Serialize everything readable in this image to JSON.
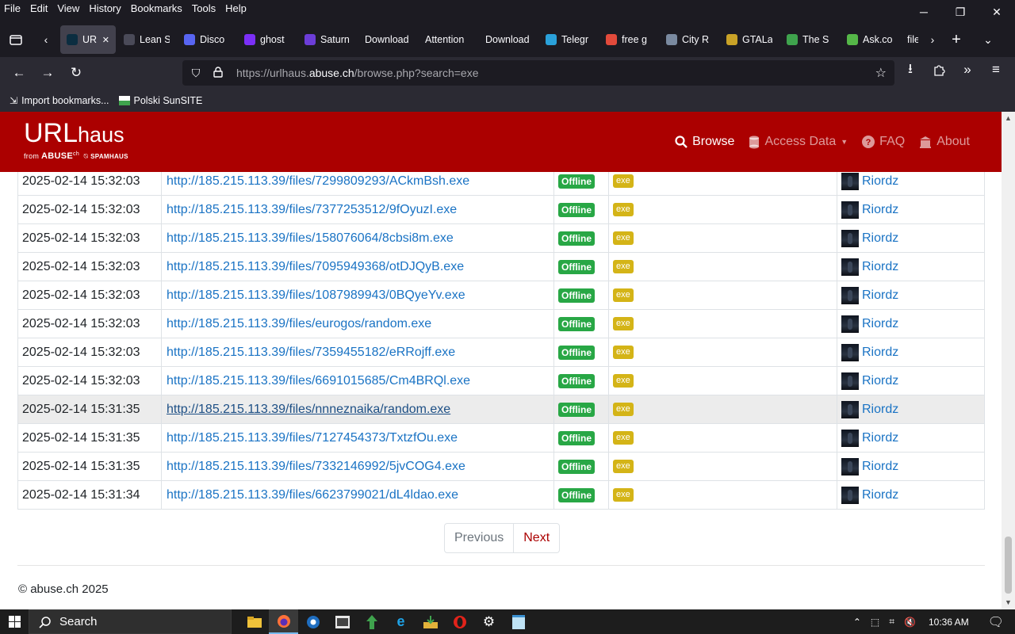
{
  "menu": [
    "File",
    "Edit",
    "View",
    "History",
    "Bookmarks",
    "Tools",
    "Help"
  ],
  "window_controls": {
    "minimize": "─",
    "restore": "❐",
    "close": "✕"
  },
  "tabs": [
    {
      "label": "URL",
      "color": "#0b2d40",
      "active": true
    },
    {
      "label": "Lean S",
      "color": "#4a4a58"
    },
    {
      "label": "Disco",
      "color": "#5865f2"
    },
    {
      "label": "ghost",
      "color": "#7b2ff7"
    },
    {
      "label": "Saturn",
      "color": "#6c3dd8"
    },
    {
      "label": "Download",
      "color": ""
    },
    {
      "label": "Attention",
      "color": ""
    },
    {
      "label": "Download",
      "color": ""
    },
    {
      "label": "Telegr",
      "color": "#2aa1da"
    },
    {
      "label": "free g",
      "color": "#e24a3b"
    },
    {
      "label": "City R",
      "color": "#7a8aa0"
    },
    {
      "label": "GTALa",
      "color": "#c9a227"
    },
    {
      "label": "The S",
      "color": "#3fa34d"
    },
    {
      "label": "Ask.co",
      "color": "#55b748"
    },
    {
      "label": "file",
      "color": ""
    }
  ],
  "url": {
    "prefix": "https://urlhaus.",
    "domain": "abuse.ch",
    "path": "/browse.php?search=exe"
  },
  "bookmarks": [
    "Import bookmarks...",
    "Polski SunSITE"
  ],
  "site": {
    "logo_main": "URL",
    "logo_sub": "haus",
    "logo_from": "from",
    "logo_abuse": "ABUSE",
    "logo_ch": "ch",
    "logo_spamhaus": "SPAMHAUS",
    "nav": [
      {
        "label": "Browse",
        "icon": "search-icon",
        "active": true
      },
      {
        "label": "Access Data",
        "icon": "database-icon",
        "active": false,
        "dropdown": true
      },
      {
        "label": "FAQ",
        "icon": "question-icon",
        "active": false
      },
      {
        "label": "About",
        "icon": "building-icon",
        "active": false
      }
    ]
  },
  "rows": [
    {
      "date": "2025-02-14 15:32:03",
      "url": "http://185.215.113.39/files/7299809293/ACkmBsh.exe",
      "status": "Offline",
      "tag": "exe",
      "reporter": "Riordz"
    },
    {
      "date": "2025-02-14 15:32:03",
      "url": "http://185.215.113.39/files/7377253512/9fOyuzI.exe",
      "status": "Offline",
      "tag": "exe",
      "reporter": "Riordz"
    },
    {
      "date": "2025-02-14 15:32:03",
      "url": "http://185.215.113.39/files/158076064/8cbsi8m.exe",
      "status": "Offline",
      "tag": "exe",
      "reporter": "Riordz"
    },
    {
      "date": "2025-02-14 15:32:03",
      "url": "http://185.215.113.39/files/7095949368/otDJQyB.exe",
      "status": "Offline",
      "tag": "exe",
      "reporter": "Riordz"
    },
    {
      "date": "2025-02-14 15:32:03",
      "url": "http://185.215.113.39/files/1087989943/0BQyeYv.exe",
      "status": "Offline",
      "tag": "exe",
      "reporter": "Riordz"
    },
    {
      "date": "2025-02-14 15:32:03",
      "url": "http://185.215.113.39/files/eurogos/random.exe",
      "status": "Offline",
      "tag": "exe",
      "reporter": "Riordz"
    },
    {
      "date": "2025-02-14 15:32:03",
      "url": "http://185.215.113.39/files/7359455182/eRRojff.exe",
      "status": "Offline",
      "tag": "exe",
      "reporter": "Riordz"
    },
    {
      "date": "2025-02-14 15:32:03",
      "url": "http://185.215.113.39/files/6691015685/Cm4BRQl.exe",
      "status": "Offline",
      "tag": "exe",
      "reporter": "Riordz"
    },
    {
      "date": "2025-02-14 15:31:35",
      "url": "http://185.215.113.39/files/nnneznaika/random.exe",
      "status": "Offline",
      "tag": "exe",
      "reporter": "Riordz",
      "hover": true
    },
    {
      "date": "2025-02-14 15:31:35",
      "url": "http://185.215.113.39/files/7127454373/TxtzfOu.exe",
      "status": "Offline",
      "tag": "exe",
      "reporter": "Riordz"
    },
    {
      "date": "2025-02-14 15:31:35",
      "url": "http://185.215.113.39/files/7332146992/5jvCOG4.exe",
      "status": "Offline",
      "tag": "exe",
      "reporter": "Riordz"
    },
    {
      "date": "2025-02-14 15:31:34",
      "url": "http://185.215.113.39/files/6623799021/dL4ldao.exe",
      "status": "Offline",
      "tag": "exe",
      "reporter": "Riordz"
    }
  ],
  "pager": {
    "prev": "Previous",
    "next": "Next"
  },
  "footer": "© abuse.ch 2025",
  "taskbar": {
    "search": "Search",
    "clock": "10:36 AM"
  }
}
